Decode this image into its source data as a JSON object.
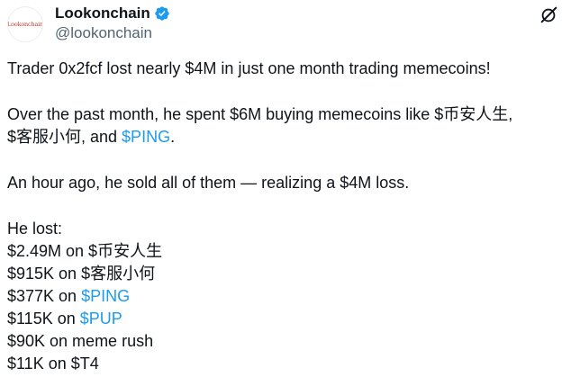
{
  "account": {
    "display_name": "Lookonchain",
    "handle": "@lookonchain",
    "avatar_text": "Lookonchain"
  },
  "icons": {
    "verified": "verified-badge-icon",
    "grok": "grok-icon"
  },
  "colors": {
    "link": "#1d9bf0",
    "text": "#0f1419",
    "muted": "#536471",
    "verified": "#1d9bf0"
  },
  "tweet": {
    "p1": "Trader 0x2fcf lost nearly $4M in just one month trading memecoins!",
    "p2_part1": "Over the past month, he spent $6M buying memecoins like $币安人生,",
    "p2_part2": "$客服小何, and ",
    "p2_link": "$PING",
    "p2_end": ".",
    "p3": "An hour ago, he sold all of them — realizing a $4M loss.",
    "p4_heading": "He lost:",
    "loss_lines": [
      {
        "prefix": "$2.49M on $币安人生",
        "link": ""
      },
      {
        "prefix": "$915K on $客服小何",
        "link": ""
      },
      {
        "prefix": "$377K on ",
        "link": "$PING"
      },
      {
        "prefix": "$115K on ",
        "link": "$PUP"
      },
      {
        "prefix": "$90K on meme rush",
        "link": ""
      },
      {
        "prefix": "$11K on $T4",
        "link": ""
      }
    ]
  }
}
